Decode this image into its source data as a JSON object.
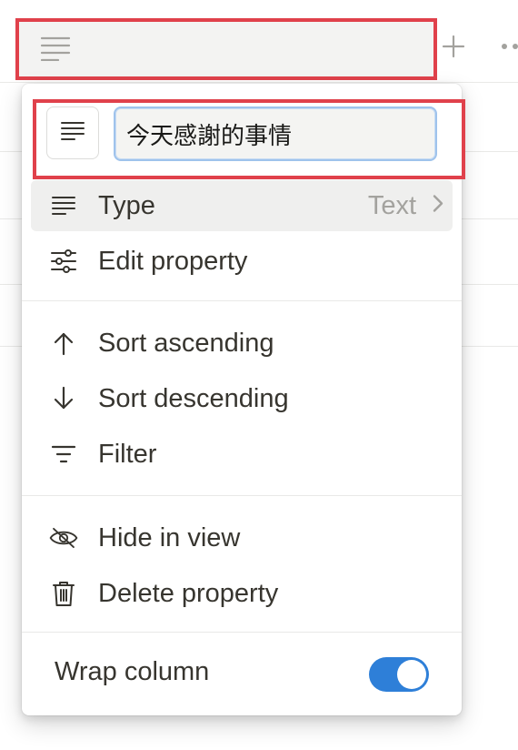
{
  "property": {
    "name_value": "今天感謝的事情",
    "icon": "text-lines-icon"
  },
  "menu": {
    "type_item": {
      "label": "Type",
      "value": "Text",
      "icon": "text-lines-icon"
    },
    "edit_property": {
      "label": "Edit property",
      "icon": "sliders-icon"
    },
    "sort_ascending": {
      "label": "Sort ascending",
      "icon": "arrow-up-icon"
    },
    "sort_descending": {
      "label": "Sort descending",
      "icon": "arrow-down-icon"
    },
    "filter": {
      "label": "Filter",
      "icon": "filter-icon"
    },
    "hide_in_view": {
      "label": "Hide in view",
      "icon": "eye-slash-icon"
    },
    "delete_property": {
      "label": "Delete property",
      "icon": "trash-icon"
    },
    "wrap_column": {
      "label": "Wrap column",
      "enabled": true
    }
  },
  "colors": {
    "highlight": "#e0414b",
    "toggle_on": "#2e7fd8",
    "input_focus": "#9fc3ec",
    "text": "#37352f",
    "muted": "#a3a29e"
  }
}
